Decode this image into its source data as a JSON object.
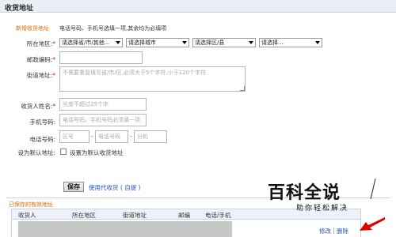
{
  "header": {
    "title": "收货地址"
  },
  "form": {
    "new_label": "新增收货地址",
    "new_hint": "电话号码、手机号选填一项,其余均为必填项",
    "region": {
      "label": "所在地区:",
      "selects": [
        "请选择省/市/其他...",
        "请选择城市",
        "请选择区/县",
        "请选择..."
      ]
    },
    "postcode": {
      "label": "邮政编码:",
      "value": ""
    },
    "street": {
      "label": "街道地址:",
      "placeholder": "不需要重复填写省/市/区,必须大于5个字符,小于120个字符"
    },
    "name": {
      "label": "收货人姓名:",
      "placeholder": "长度不超过25个字"
    },
    "mobile": {
      "label": "手机号码:",
      "placeholder": "电话号码、手机号码必须填一项"
    },
    "phone": {
      "label": "电话号码:",
      "area_placeholder": "区号",
      "number_placeholder": "电话号码",
      "ext_placeholder": "分机",
      "dash": "-"
    },
    "default": {
      "label": "设为默认地址:",
      "checkbox_label": "设置为默认收货地址",
      "checked": false
    },
    "save_label": "保存",
    "use_agent_label": "使用代收货 ( 自提 )"
  },
  "saved": {
    "title": "已保存的有效地址",
    "columns": [
      "收货人",
      "所在地区",
      "街道地址",
      "邮编",
      "电话/手机"
    ],
    "row_actions": {
      "edit": "修改",
      "delete": "删除",
      "separator": "|"
    }
  },
  "watermark": {
    "logo": "百科全说",
    "sub": "助你轻松解决"
  },
  "colors": {
    "accent_orange": "#e06b00",
    "link_blue": "#1f56c8",
    "required_red": "#e00000"
  }
}
